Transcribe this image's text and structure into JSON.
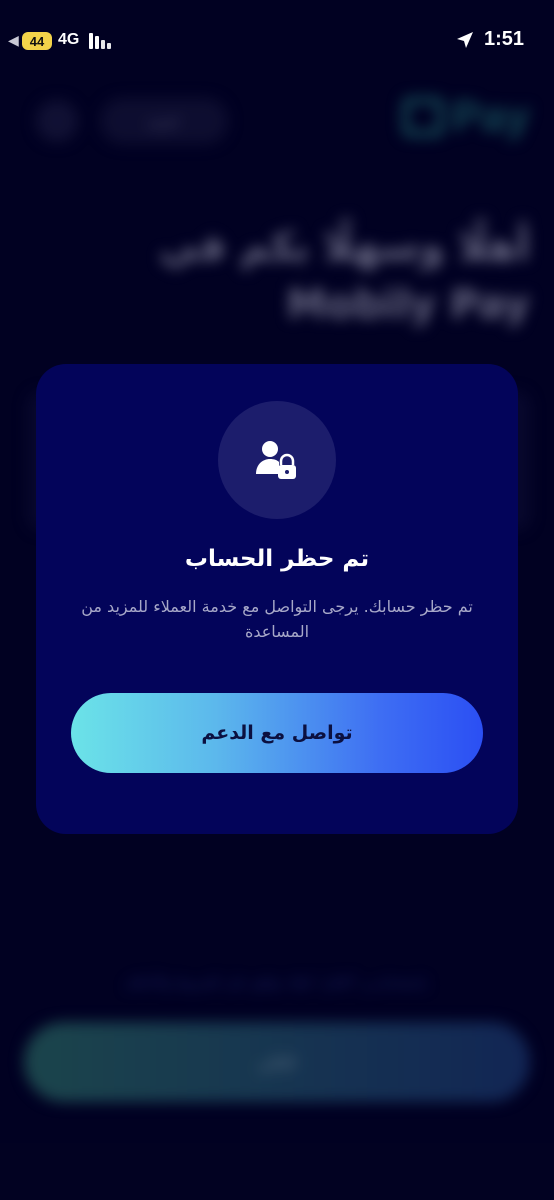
{
  "status_bar": {
    "battery": "44",
    "network": "4G",
    "time": "1:51"
  },
  "background": {
    "language_toggle": "عربي",
    "logo_text": "Pay",
    "welcome": "أهلًا وسهلًا بكم في Mobily Pay",
    "terms": "باستخدام زر \"التالي\" فإنك توافق على الشروط والأحكام",
    "next_button": "التالي"
  },
  "modal": {
    "icon": "user-lock-icon",
    "title": "تم حظر الحساب",
    "message": "تم حظر حسابك. يرجى التواصل مع خدمة العملاء للمزيد من المساعدة",
    "button_label": "تواصل مع الدعم"
  },
  "colors": {
    "background": "#02022a",
    "modal": "#03045a",
    "icon_circle": "#1c1d6c",
    "button_gradient_start": "#6be3e8",
    "button_gradient_end": "#2b4ff3",
    "battery_badge": "#f3d34a"
  }
}
